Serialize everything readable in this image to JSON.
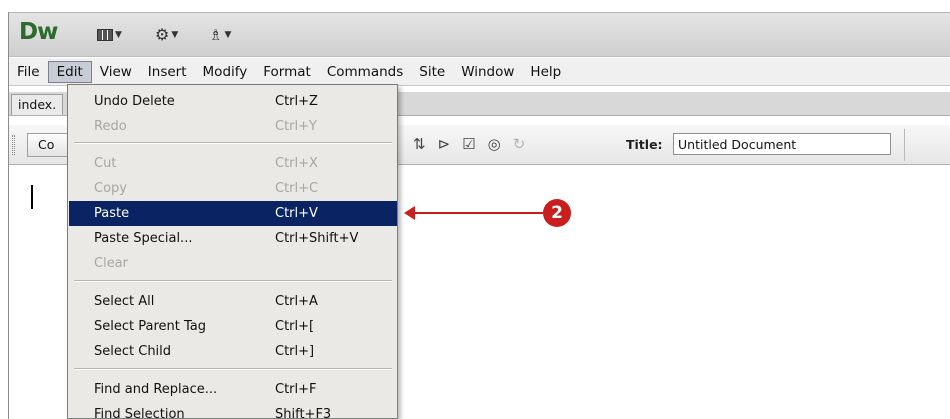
{
  "app": {
    "logo": "Dw"
  },
  "app_toolbar": {
    "buttons": [
      {
        "icon": "layout-icon"
      },
      {
        "icon": "gear-icon"
      },
      {
        "icon": "site-icon"
      }
    ]
  },
  "menubar": {
    "items": [
      "File",
      "Edit",
      "View",
      "Insert",
      "Modify",
      "Format",
      "Commands",
      "Site",
      "Window",
      "Help"
    ],
    "active": "Edit"
  },
  "document": {
    "tab_label": "index.",
    "code_button": "Co",
    "title_label": "Title:",
    "title_value": "Untitled Document"
  },
  "edit_menu": {
    "items": [
      {
        "label": "Undo Delete",
        "shortcut": "Ctrl+Z",
        "enabled": true
      },
      {
        "label": "Redo",
        "shortcut": "Ctrl+Y",
        "enabled": false
      },
      {
        "label": "Cut",
        "shortcut": "Ctrl+X",
        "enabled": false
      },
      {
        "label": "Copy",
        "shortcut": "Ctrl+C",
        "enabled": false
      },
      {
        "label": "Paste",
        "shortcut": "Ctrl+V",
        "enabled": true,
        "highlighted": true
      },
      {
        "label": "Paste Special...",
        "shortcut": "Ctrl+Shift+V",
        "enabled": true
      },
      {
        "label": "Clear",
        "shortcut": "",
        "enabled": false
      },
      {
        "label": "Select All",
        "shortcut": "Ctrl+A",
        "enabled": true
      },
      {
        "label": "Select Parent Tag",
        "shortcut": "Ctrl+[",
        "enabled": true
      },
      {
        "label": "Select Child",
        "shortcut": "Ctrl+]",
        "enabled": true
      },
      {
        "label": "Find and Replace...",
        "shortcut": "Ctrl+F",
        "enabled": true
      },
      {
        "label": "Find Selection",
        "shortcut": "Shift+F3",
        "enabled": true
      }
    ]
  },
  "annotation": {
    "badge": "2",
    "color": "#c81e1e"
  },
  "colors": {
    "highlight": "#0a2463",
    "logo": "#2d6b2d"
  }
}
